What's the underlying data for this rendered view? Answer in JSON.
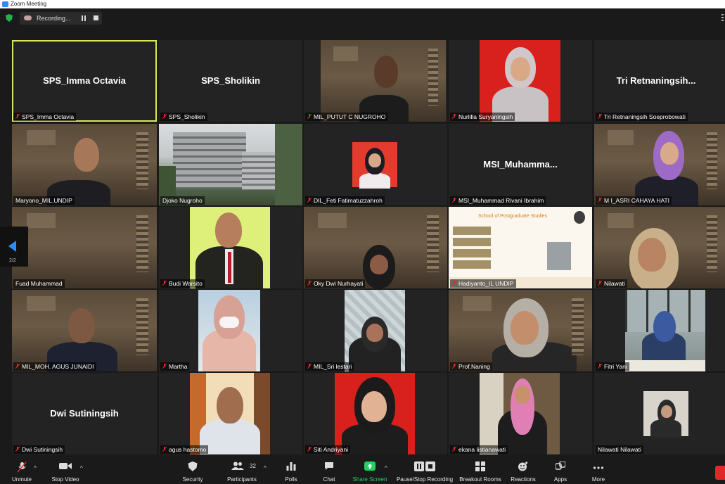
{
  "window": {
    "title": "Zoom Meeting"
  },
  "recording": {
    "label": "Recording..."
  },
  "pager": {
    "page": "2/2"
  },
  "tiles": [
    {
      "big": "SPS_Imma Octavia",
      "label": "SPS_Imma Octavia"
    },
    {
      "big": "SPS_Sholikin",
      "label": "SPS_Sholikin"
    },
    {
      "label": "MIL_PUTUT C NUGROHO"
    },
    {
      "label": "Nurlilla Suryaningsih"
    },
    {
      "big": "Tri  Retnaningsih...",
      "label": "Tri Retnaningsih Soeprobowati"
    },
    {
      "label": "Maryono_MIL.UNDIP"
    },
    {
      "label": "Djoko Nugroho"
    },
    {
      "label": "DIL_Feti Fatimatuzzahroh"
    },
    {
      "big": "MSI_Muhamma...",
      "label": "MSI_Muhammad Rivani Ibrahim"
    },
    {
      "label": "M I_ASRI CAHAYA HATI"
    },
    {
      "label": "Fuad Muhammad"
    },
    {
      "label": "Budi Warsito"
    },
    {
      "label": "Oky Dwi Nurhayati"
    },
    {
      "label": "Hadiyanto_IL UNDIP",
      "slide_title": "School of Postgraduate Studies"
    },
    {
      "label": "Nilawati"
    },
    {
      "label": "MIL_MOH. AGUS JUNAIDI"
    },
    {
      "label": "Martha"
    },
    {
      "label": "MIL_Sri lestari"
    },
    {
      "label": "Prof.Naning"
    },
    {
      "label": "Fitri Yani"
    },
    {
      "big": "Dwi Sutiningsih",
      "label": "Dwi Sutiningsih"
    },
    {
      "label": "agus hastomo"
    },
    {
      "label": "Siti Andriyani"
    },
    {
      "label": "ekana listianawati"
    },
    {
      "label": "Nilawati Nilawati"
    }
  ],
  "toolbar": {
    "unmute": "Unmute",
    "stop_video": "Stop Video",
    "security": "Security",
    "participants": "Participants",
    "participants_count": "32",
    "polls": "Polls",
    "chat": "Chat",
    "share_screen": "Share Screen",
    "record": "Pause/Stop Recording",
    "breakout": "Breakout Rooms",
    "reactions": "Reactions",
    "apps": "Apps",
    "more": "More"
  },
  "colors": {
    "accent": "#2d8cff",
    "active_speaker": "#d9e85a",
    "share_green": "#23d160",
    "muted_red": "#e02828"
  }
}
